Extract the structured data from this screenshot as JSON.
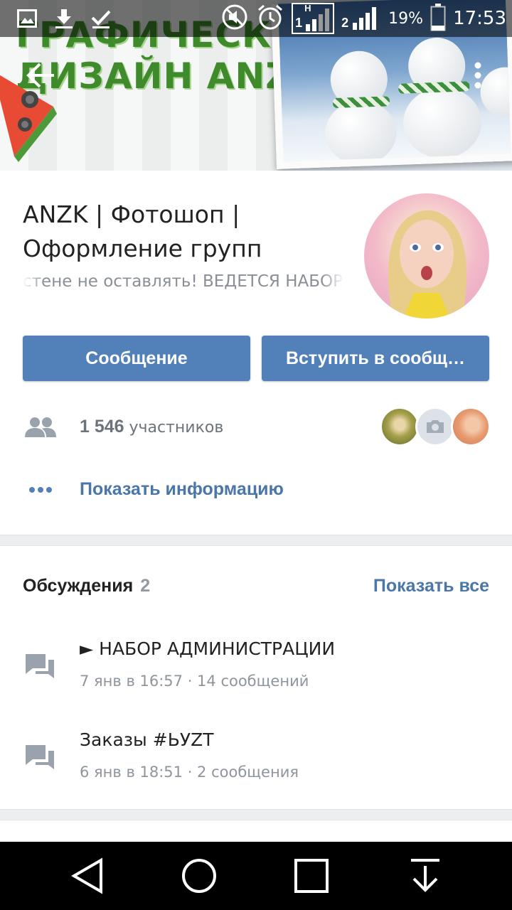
{
  "status_bar": {
    "time": "17:53",
    "battery": "19%",
    "sim1_label": "1",
    "sim2_label": "2",
    "network_label": "H",
    "icons": [
      "image-icon",
      "download-icon",
      "check-icon",
      "mute-icon",
      "alarm-icon",
      "signal-icon",
      "battery-icon"
    ]
  },
  "cover": {
    "title": "ГРАФИЧЕСКИЙ\nДИЗАЙН ANZK"
  },
  "group": {
    "name": "ANZK | Фотошоп | Оформление групп",
    "status": "стене не оставлять! ВЕДЕТСЯ НАБОР"
  },
  "buttons": {
    "message": "Сообщение",
    "join": "Вступить в сообщ…"
  },
  "members": {
    "count": "1 546",
    "word": "участников"
  },
  "info": {
    "show_info": "Показать информацию"
  },
  "discussions": {
    "title": "Обсуждения",
    "count": "2",
    "show_all": "Показать все",
    "topics": [
      {
        "title": "► НАБОР АДМИНИСТРАЦИИ",
        "meta": "7 янв в 16:57 · 14 сообщений"
      },
      {
        "title": "Заказы #ЬУZT",
        "meta": "6 янв в 18:51 · 2 сообщения"
      }
    ]
  },
  "colors": {
    "accent": "#5181b8",
    "link": "#4a76a8",
    "secondary_text": "#8f959c"
  }
}
